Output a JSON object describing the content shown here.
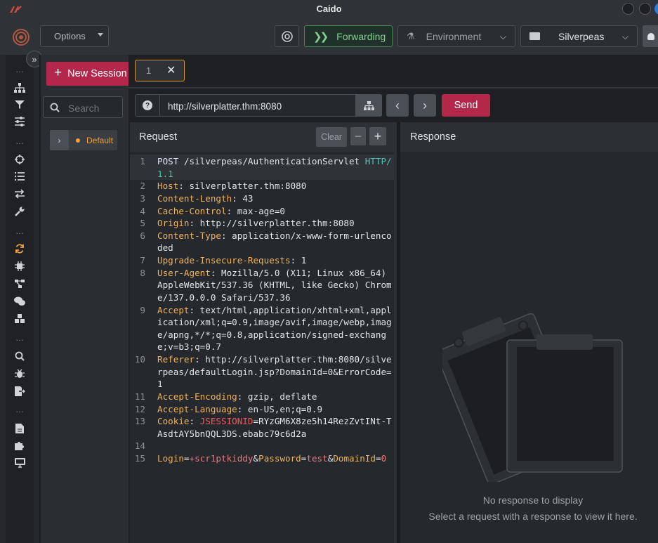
{
  "app": {
    "title": "Caido"
  },
  "toolbar": {
    "options_label": "Options",
    "forwarding_label": "Forwarding",
    "environment_label": "Environment",
    "project_label": "Silverpeas"
  },
  "sessions": {
    "new_session_label": "New Session",
    "search_placeholder": "Search",
    "collection_label": "Default"
  },
  "tab": {
    "label": "1"
  },
  "urlbar": {
    "url": "http://silverplatter.thm:8080",
    "send_label": "Send"
  },
  "request": {
    "title": "Request",
    "clear_label": "Clear",
    "lines": [
      {
        "n": "1",
        "method": "POST",
        "path": " /silverpeas/AuthenticationServlet ",
        "proto1": "HTTP/",
        "proto2": "1.1"
      },
      {
        "n": "2",
        "key": "Host",
        "val": ": silverplatter.thm:8080"
      },
      {
        "n": "3",
        "key": "Content-Length",
        "val": ": 43"
      },
      {
        "n": "4",
        "key": "Cache-Control",
        "val": ": max-age=0"
      },
      {
        "n": "5",
        "key": "Origin",
        "val": ": http://silverplatter.thm:8080"
      },
      {
        "n": "6",
        "key": "Content-Type",
        "val": ": application/x-www-form-urlenco",
        "cont": [
          "ded"
        ]
      },
      {
        "n": "7",
        "key": "Upgrade-Insecure-Requests",
        "val": ": 1"
      },
      {
        "n": "8",
        "key": "User-Agent",
        "val": ": Mozilla/5.0 (X11; Linux x86_64)",
        "cont": [
          "AppleWebKit/537.36 (KHTML, like Gecko) Chrom",
          "e/137.0.0.0 Safari/537.36"
        ]
      },
      {
        "n": "9",
        "key": "Accept",
        "val": ": text/html,application/xhtml+xml,appl",
        "cont": [
          "ication/xml;q=0.9,image/avif,image/webp,imag",
          "e/apng,*/*;q=0.8,application/signed-exchang",
          "e;v=b3;q=0.7"
        ]
      },
      {
        "n": "10",
        "key": "Referer",
        "val": ": http://silverplatter.thm:8080/silve",
        "cont": [
          "rpeas/defaultLogin.jsp?DomainId=0&ErrorCode=",
          "1"
        ]
      },
      {
        "n": "11",
        "key": "Accept-Encoding",
        "val": ": gzip, deflate"
      },
      {
        "n": "12",
        "key": "Accept-Language",
        "val": ": en-US,en;q=0.9"
      },
      {
        "n": "13",
        "key": "Cookie",
        "val": ": ",
        "ckey": "JSESSIONID",
        "cval": "=RYzGM6X8ze5h14RezZvtINt-T",
        "cont": [
          "AsdtAY5bnQQL3DS.ebabc79c6d2a"
        ]
      },
      {
        "n": "14"
      },
      {
        "n": "15",
        "body": true
      }
    ],
    "body": {
      "k1": "Login",
      "v1": "+scr1ptkiddy",
      "amp1": "&",
      "k2": "Password",
      "v2": "test",
      "amp2": "&",
      "k3": "DomainId",
      "v3": "0",
      "eq": "="
    }
  },
  "response": {
    "title": "Response",
    "empty_title": "No response to display",
    "empty_hint": "Select a request with a response to view it here."
  },
  "icons": {
    "logo": "caido-logo-icon",
    "accent": "#b3284a",
    "forward_color": "#7fd08a"
  }
}
